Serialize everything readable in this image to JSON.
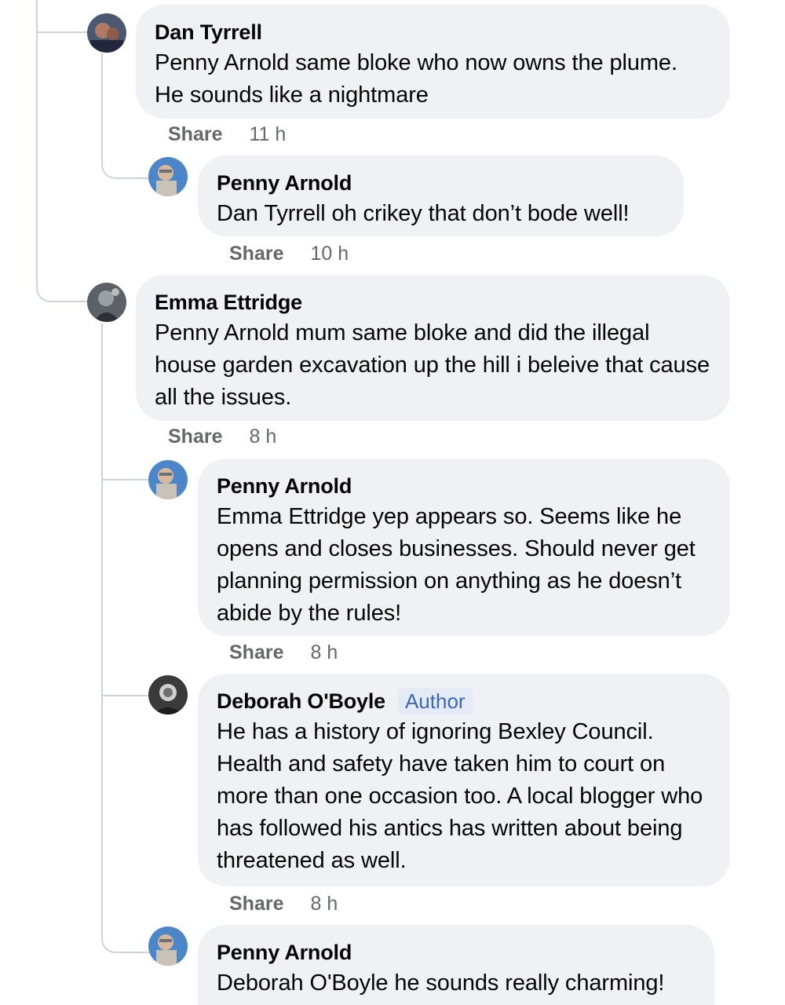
{
  "comments": [
    {
      "author": "Dan Tyrrell",
      "text": "Penny Arnold same bloke who now owns the plume. He sounds like a nightmare",
      "share_label": "Share",
      "time": "11 h"
    },
    {
      "author": "Penny Arnold",
      "text": "Dan Tyrrell oh crikey that don’t bode well!",
      "share_label": "Share",
      "time": "10 h"
    },
    {
      "author": "Emma Ettridge",
      "text": "Penny Arnold mum same bloke and did the illegal house garden excavation up the hill i beleive that cause all the issues.",
      "share_label": "Share",
      "time": "8 h"
    },
    {
      "author": "Penny Arnold",
      "text": "Emma Ettridge yep appears so. Seems like he opens and closes businesses. Should never get planning permission on anything as he doesn’t abide by the rules!",
      "share_label": "Share",
      "time": "8 h"
    },
    {
      "author": "Deborah O'Boyle",
      "badge": "Author",
      "text": "He has a history of ignoring Bexley Council. Health and safety have taken him to court on more than one occasion too. A local blogger who has followed his antics has written about being threatened as well.",
      "share_label": "Share",
      "time": "8 h"
    },
    {
      "author": "Penny Arnold",
      "text": "Deborah O'Boyle he sounds really charming!"
    }
  ],
  "colors": {
    "bubble": "#eff1f4",
    "thread_line": "#cfd3d8",
    "meta_text": "#65676b",
    "author_badge_bg": "#e4ebf7",
    "author_badge_text": "#3a67b8"
  }
}
